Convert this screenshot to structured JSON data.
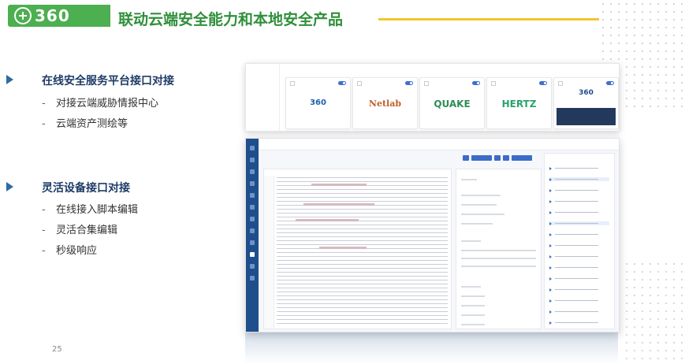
{
  "header": {
    "logo_text": "360",
    "title": "联动云端安全能力和本地安全产品"
  },
  "sections": [
    {
      "heading": "在线安全服务平台接口对接",
      "items": [
        "对接云端威胁情报中心",
        "云端资产测绘等"
      ]
    },
    {
      "heading": "灵活设备接口对接",
      "items": [
        "在线接入脚本编辑",
        "灵活合集编辑",
        "秒级响应"
      ]
    }
  ],
  "bullet_dash": "-",
  "page_number": "25",
  "integrations": {
    "cards": [
      {
        "brand": "360",
        "color": "#1f5fa8"
      },
      {
        "brand": "Netlab",
        "color": "#c0602a"
      },
      {
        "brand": "QUAKE",
        "color": "#2d8f57"
      },
      {
        "brand": "HERTZ",
        "color": "#2aa36a"
      },
      {
        "brand": "360",
        "color": "#1f4e8c"
      }
    ]
  },
  "colors": {
    "brand_green": "#4caf50",
    "title_green": "#2f8f3b",
    "accent_yellow": "#f4c430",
    "heading_navy": "#1f3c66",
    "bullet_blue": "#2b6ca3",
    "rail_blue": "#1f4e8c"
  }
}
